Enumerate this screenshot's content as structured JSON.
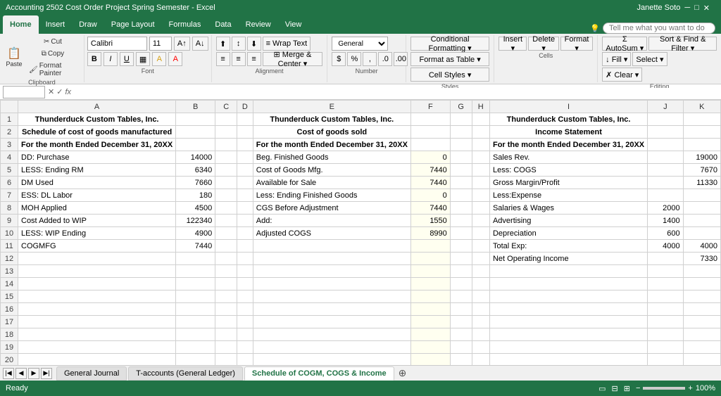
{
  "titleBar": {
    "title": "Accounting 2502 Cost Order Project Spring Semester - Excel",
    "user": "Janette Soto"
  },
  "ribbonTabs": [
    "Home",
    "Insert",
    "Draw",
    "Page Layout",
    "Formulas",
    "Data",
    "Review",
    "View"
  ],
  "activeTab": "Home",
  "searchPlaceholder": "Tell me what you want to do",
  "clipboard": {
    "label": "Clipboard",
    "cut": "Cut",
    "copy": "Copy",
    "formatPainter": "Format Painter"
  },
  "font": {
    "name": "Calibri",
    "size": "11",
    "bold": "B",
    "italic": "I",
    "underline": "U"
  },
  "alignment": {
    "label": "Alignment",
    "wrapText": "Wrap Text",
    "mergeCenter": "Merge & Center"
  },
  "number": {
    "label": "Number",
    "format": "General",
    "dollarSign": "$",
    "percent": "%",
    "comma": ",",
    "decimal_inc": ".0",
    "decimal_dec": ".00"
  },
  "styles": {
    "label": "Styles",
    "conditional": "Conditional Formatting",
    "formatAsTable": "Format as Table",
    "cellStyles": "Cell Styles"
  },
  "cells": {
    "label": "Cells",
    "insert": "Insert",
    "delete": "Delete",
    "format": "Format"
  },
  "editing": {
    "label": "Editing",
    "autoSum": "AutoSum",
    "fill": "Fill",
    "clear": "Clear",
    "sortFind": "Sort & Find & Filter",
    "select": "Select"
  },
  "formulaBar": {
    "nameBox": "",
    "formula": "fx"
  },
  "columnHeaders": [
    "A",
    "B",
    "C",
    "D",
    "E",
    "F",
    "G",
    "H",
    "I",
    "J",
    "K"
  ],
  "rows": [
    {
      "rowNum": "1",
      "cells": {
        "A": "Thunderduck Custom Tables, Inc.",
        "B": "",
        "C": "",
        "D": "",
        "E": "Thunderduck Custom Tables, Inc.",
        "F": "",
        "G": "",
        "H": "",
        "I": "Thunderduck Custom Tables, Inc.",
        "J": "",
        "K": ""
      }
    },
    {
      "rowNum": "2",
      "cells": {
        "A": "Schedule of cost of goods manufactured",
        "B": "",
        "C": "",
        "D": "",
        "E": "Cost of goods sold",
        "F": "",
        "G": "",
        "H": "",
        "I": "Income Statement",
        "J": "",
        "K": ""
      }
    },
    {
      "rowNum": "3",
      "cells": {
        "A": "For the month Ended December 31, 20XX",
        "B": "",
        "C": "",
        "D": "",
        "E": "For the month Ended December 31, 20XX",
        "F": "",
        "G": "",
        "H": "",
        "I": "For the month Ended December 31, 20XX",
        "J": "",
        "K": ""
      }
    },
    {
      "rowNum": "4",
      "cells": {
        "A": "DD: Purchase",
        "B": "14000",
        "C": "",
        "D": "",
        "E": "Beg. Finished Goods",
        "F": "0",
        "G": "",
        "H": "",
        "I": "Sales Rev.",
        "J": "",
        "K": "19000"
      }
    },
    {
      "rowNum": "5",
      "cells": {
        "A": "LESS: Ending RM",
        "B": "6340",
        "C": "",
        "D": "",
        "E": "Cost of Goods Mfg.",
        "F": "7440",
        "G": "",
        "H": "",
        "I": "Less: COGS",
        "J": "",
        "K": "7670"
      }
    },
    {
      "rowNum": "6",
      "cells": {
        "A": "DM Used",
        "B": "7660",
        "C": "",
        "D": "",
        "E": "Available for Sale",
        "F": "7440",
        "G": "",
        "H": "",
        "I": "Gross Margin/Profit",
        "J": "",
        "K": "11330"
      }
    },
    {
      "rowNum": "7",
      "cells": {
        "A": "ESS: DL Labor",
        "B": "180",
        "C": "",
        "D": "",
        "E": "Less: Ending Finished Goods",
        "F": "0",
        "G": "",
        "H": "",
        "I": "Less:Expense",
        "J": "",
        "K": ""
      }
    },
    {
      "rowNum": "8",
      "cells": {
        "A": "MOH Applied",
        "B": "4500",
        "C": "",
        "D": "",
        "E": "CGS Before Adjustment",
        "F": "7440",
        "G": "",
        "H": "",
        "I": "Salaries & Wages",
        "J": "2000",
        "K": ""
      }
    },
    {
      "rowNum": "9",
      "cells": {
        "A": "Cost Added to WIP",
        "B": "122340",
        "C": "",
        "D": "",
        "E": "Add:",
        "F": "1550",
        "G": "",
        "H": "",
        "I": "Advertising",
        "J": "1400",
        "K": ""
      }
    },
    {
      "rowNum": "10",
      "cells": {
        "A": "LESS: WIP Ending",
        "B": "4900",
        "C": "",
        "D": "",
        "E": "Adjusted COGS",
        "F": "8990",
        "G": "",
        "H": "",
        "I": "Depreciation",
        "J": "600",
        "K": ""
      }
    },
    {
      "rowNum": "11",
      "cells": {
        "A": "COGMFG",
        "B": "7440",
        "C": "",
        "D": "",
        "E": "",
        "F": "",
        "G": "",
        "H": "",
        "I": "Total Exp:",
        "J": "4000",
        "K": "4000"
      }
    },
    {
      "rowNum": "12",
      "cells": {
        "A": "",
        "B": "",
        "C": "",
        "D": "",
        "E": "",
        "F": "",
        "G": "",
        "H": "",
        "I": "Net Operating Income",
        "J": "",
        "K": "7330"
      }
    },
    {
      "rowNum": "13",
      "cells": {
        "A": "",
        "B": "",
        "C": "",
        "D": "",
        "E": "",
        "F": "",
        "G": "",
        "H": "",
        "I": "",
        "J": "",
        "K": ""
      }
    },
    {
      "rowNum": "14",
      "cells": {
        "A": "",
        "B": "",
        "C": "",
        "D": "",
        "E": "",
        "F": "",
        "G": "",
        "H": "",
        "I": "",
        "J": "",
        "K": ""
      }
    },
    {
      "rowNum": "15",
      "cells": {
        "A": "",
        "B": "",
        "C": "",
        "D": "",
        "E": "",
        "F": "",
        "G": "",
        "H": "",
        "I": "",
        "J": "",
        "K": ""
      }
    },
    {
      "rowNum": "16",
      "cells": {
        "A": "",
        "B": "",
        "C": "",
        "D": "",
        "E": "",
        "F": "",
        "G": "",
        "H": "",
        "I": "",
        "J": "",
        "K": ""
      }
    },
    {
      "rowNum": "17",
      "cells": {
        "A": "",
        "B": "",
        "C": "",
        "D": "",
        "E": "",
        "F": "",
        "G": "",
        "H": "",
        "I": "",
        "J": "",
        "K": ""
      }
    },
    {
      "rowNum": "18",
      "cells": {
        "A": "",
        "B": "",
        "C": "",
        "D": "",
        "E": "",
        "F": "",
        "G": "",
        "H": "",
        "I": "",
        "J": "",
        "K": ""
      }
    },
    {
      "rowNum": "19",
      "cells": {
        "A": "",
        "B": "",
        "C": "",
        "D": "",
        "E": "",
        "F": "",
        "G": "",
        "H": "",
        "I": "",
        "J": "",
        "K": ""
      }
    },
    {
      "rowNum": "20",
      "cells": {
        "A": "",
        "B": "",
        "C": "",
        "D": "",
        "E": "",
        "F": "",
        "G": "",
        "H": "",
        "I": "",
        "J": "",
        "K": ""
      }
    },
    {
      "rowNum": "21",
      "cells": {
        "A": "",
        "B": "",
        "C": "",
        "D": "",
        "E": "",
        "F": "",
        "G": "",
        "H": "",
        "I": "",
        "J": "",
        "K": ""
      }
    },
    {
      "rowNum": "22",
      "cells": {
        "A": "",
        "B": "",
        "C": "",
        "D": "",
        "E": "",
        "F": "",
        "G": "",
        "H": "",
        "I": "",
        "J": "",
        "K": ""
      }
    }
  ],
  "sheetTabs": [
    "General Journal",
    "T-accounts (General Ledger)",
    "Schedule of COGM, COGS & Income"
  ],
  "activeSheet": "Schedule of COGM, COGS & Income",
  "statusBar": {
    "ready": "Ready",
    "zoom": "100%",
    "zoomIn": "+",
    "zoomOut": "-"
  }
}
